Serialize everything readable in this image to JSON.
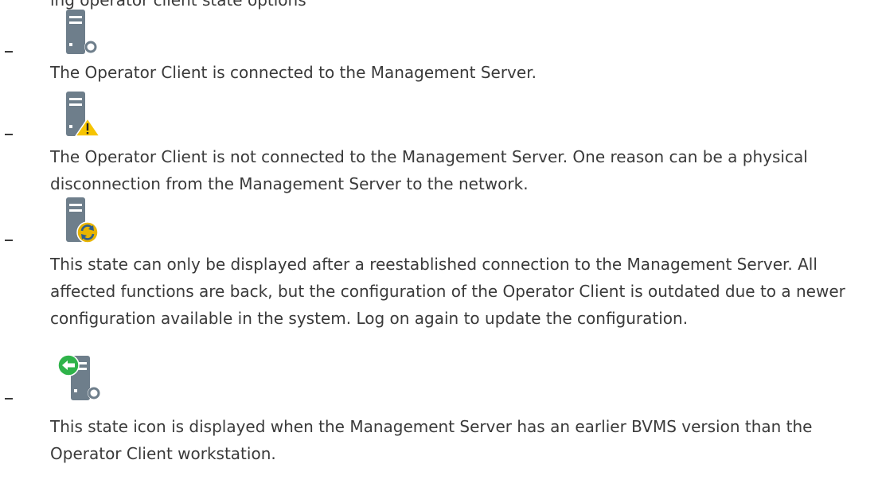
{
  "top_partial_line": "ing operator client state options",
  "items": [
    {
      "icon": "server-connected-icon",
      "marker": "–",
      "text": "The Operator Client is connected to the Management Server."
    },
    {
      "icon": "server-warning-icon",
      "marker": "–",
      "text": "The Operator Client is not connected to the Management Server. One reason can be a physical disconnection from the Management Server to the network."
    },
    {
      "icon": "server-sync-icon",
      "marker": "–",
      "text": "This state can only be displayed after a reestablished connection to the Management Server. All affected functions are back, but the configuration of the Operator Client is outdated due to a newer configuration available in the system. Log on again to update the configuration."
    },
    {
      "icon": "server-earlier-version-icon",
      "marker": "–",
      "text": "This state icon is displayed when the Management Server has an earlier BVMS version than the Operator Client workstation."
    }
  ],
  "colors": {
    "text": "#3a3a3a",
    "server_body": "#6e7e8b",
    "warning": "#f6c400",
    "sync": "#e8b400",
    "green": "#2fb34a"
  }
}
